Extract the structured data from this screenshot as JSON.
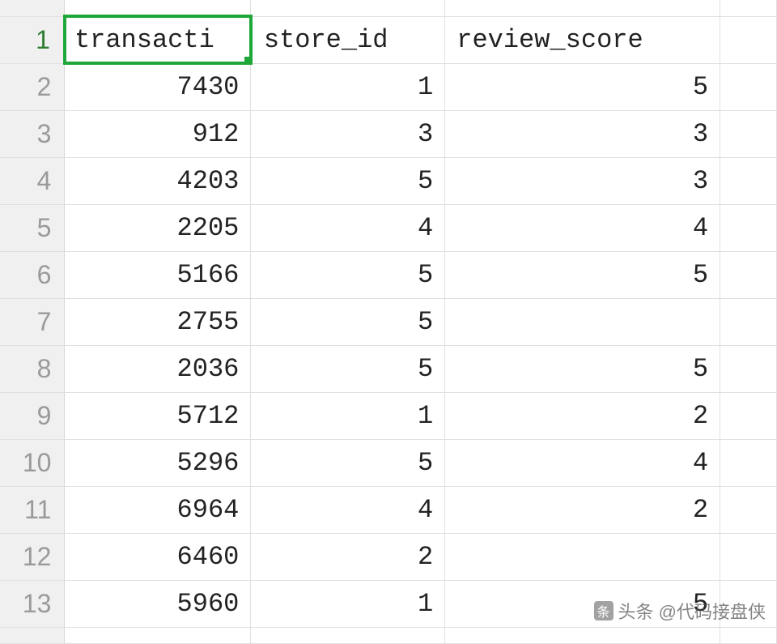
{
  "columns": {
    "a": "transacti",
    "b": "store_id",
    "c": "review_score"
  },
  "rows": [
    {
      "num": "1"
    },
    {
      "num": "2",
      "a": "7430",
      "b": "1",
      "c": "5"
    },
    {
      "num": "3",
      "a": "912",
      "b": "3",
      "c": "3"
    },
    {
      "num": "4",
      "a": "4203",
      "b": "5",
      "c": "3"
    },
    {
      "num": "5",
      "a": "2205",
      "b": "4",
      "c": "4"
    },
    {
      "num": "6",
      "a": "5166",
      "b": "5",
      "c": "5"
    },
    {
      "num": "7",
      "a": "2755",
      "b": "5",
      "c": ""
    },
    {
      "num": "8",
      "a": "2036",
      "b": "5",
      "c": "5"
    },
    {
      "num": "9",
      "a": "5712",
      "b": "1",
      "c": "2"
    },
    {
      "num": "10",
      "a": "5296",
      "b": "5",
      "c": "4"
    },
    {
      "num": "11",
      "a": "6964",
      "b": "4",
      "c": "2"
    },
    {
      "num": "12",
      "a": "6460",
      "b": "2",
      "c": ""
    },
    {
      "num": "13",
      "a": "5960",
      "b": "1",
      "c": "5"
    }
  ],
  "watermark": {
    "text": "头条 @代码接盘侠"
  }
}
